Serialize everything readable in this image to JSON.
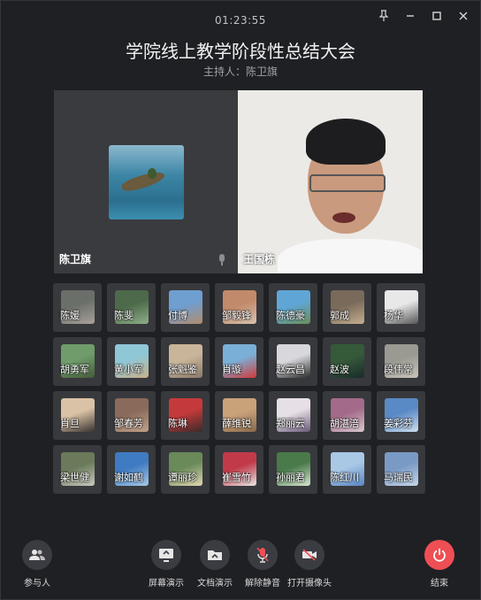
{
  "window": {
    "timer": "01:23:55",
    "controls": [
      "pin-icon",
      "minimize-icon",
      "maximize-icon",
      "close-icon"
    ]
  },
  "meeting": {
    "title": "学院线上教学阶段性总结大会",
    "host": "主持人：陈卫旗"
  },
  "stage": {
    "left_name": "陈卫旗",
    "right_name": "王国栋"
  },
  "participants": [
    {
      "name": "陈媛",
      "c1": "#6b6f6a",
      "c2": "#a9a29a"
    },
    {
      "name": "陈斐",
      "c1": "#4d6a4a",
      "c2": "#8fb08a"
    },
    {
      "name": "付博",
      "c1": "#6f9ed0",
      "c2": "#b38c6c"
    },
    {
      "name": "邹毅锋",
      "c1": "#c28a6a",
      "c2": "#d8c2b0"
    },
    {
      "name": "陈德豪",
      "c1": "#5fa6d6",
      "c2": "#6a8f5a"
    },
    {
      "name": "郭成",
      "c1": "#7a6a5a",
      "c2": "#c4b090"
    },
    {
      "name": "杨华",
      "c1": "#e8e8e8",
      "c2": "#555555"
    },
    {
      "name": "胡勇军",
      "c1": "#6f9c6a",
      "c2": "#445a3a"
    },
    {
      "name": "黄小军",
      "c1": "#8fc7d6",
      "c2": "#c9b08a"
    },
    {
      "name": "张魁鉴",
      "c1": "#c9b59a",
      "c2": "#8a7a6a"
    },
    {
      "name": "肖璇",
      "c1": "#7ab0d8",
      "c2": "#d23a3a"
    },
    {
      "name": "赵云昌",
      "c1": "#d8d8dc",
      "c2": "#2c2c2c"
    },
    {
      "name": "赵波",
      "c1": "#355a3a",
      "c2": "#1a2a2a"
    },
    {
      "name": "段伟常",
      "c1": "#9a9a92",
      "c2": "#c9c4b8"
    },
    {
      "name": "肖旦",
      "c1": "#d9c2a5",
      "c2": "#3a3230"
    },
    {
      "name": "邹春芳",
      "c1": "#8a6a5a",
      "c2": "#c2a28a"
    },
    {
      "name": "陈琳",
      "c1": "#c43a3a",
      "c2": "#3a2a2a"
    },
    {
      "name": "薛维锐",
      "c1": "#c9a27a",
      "c2": "#8a6a4a"
    },
    {
      "name": "郑丽云",
      "c1": "#e6e0e6",
      "c2": "#6a5a7a"
    },
    {
      "name": "胡湛涪",
      "c1": "#a46a8a",
      "c2": "#d8c9d0"
    },
    {
      "name": "姜彩芬",
      "c1": "#5a8ac6",
      "c2": "#cfe0ee"
    },
    {
      "name": "梁世健",
      "c1": "#6a7a5a",
      "c2": "#c9c9c0"
    },
    {
      "name": "谢如鹤",
      "c1": "#3f7bc2",
      "c2": "#a6c8e6"
    },
    {
      "name": "谭丽珍",
      "c1": "#6a8a5a",
      "c2": "#e0d6b0"
    },
    {
      "name": "崔雪竹",
      "c1": "#c23a4a",
      "c2": "#e6e6e6"
    },
    {
      "name": "孙丽君",
      "c1": "#4a7a4a",
      "c2": "#d6e6d0"
    },
    {
      "name": "陈红川",
      "c1": "#a8c8e6",
      "c2": "#5a86c2"
    },
    {
      "name": "马瑞民",
      "c1": "#7a9ac6",
      "c2": "#c6d6e6"
    }
  ],
  "toolbar": {
    "participants": "参与人",
    "screen_share": "屏幕演示",
    "doc_share": "文档演示",
    "unmute": "解除静音",
    "camera": "打开摄像头",
    "end": "结束"
  },
  "colors": {
    "background": "#1f2024",
    "tile": "#38393d",
    "end_button": "#ee4f55"
  }
}
